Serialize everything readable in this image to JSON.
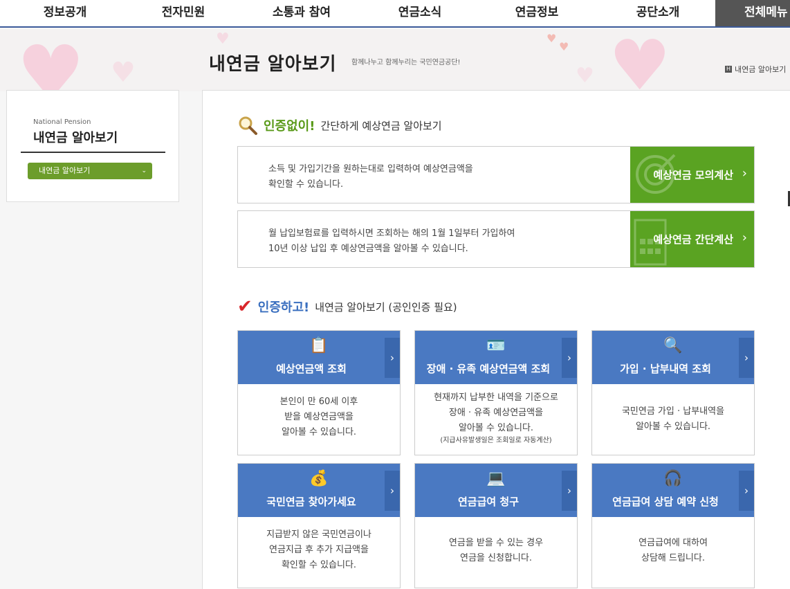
{
  "gnb": {
    "items": [
      "정보공개",
      "전자민원",
      "소통과 참여",
      "연금소식",
      "연금정보",
      "공단소개"
    ],
    "all_menu": "전체메뉴"
  },
  "header": {
    "title": "내연금 알아보기",
    "subtitle": "함께나누고 함께누리는 국민연금공단!",
    "breadcrumb": "내연금 알아보기"
  },
  "sidebar": {
    "eng_title": "National Pension",
    "title": "내연금 알아보기",
    "menu_label": "내연금 알아보기",
    "menu_color": "#6c9d2b"
  },
  "section1": {
    "emphasis": "인증없이!",
    "rest": "간단하게 예상연금 알아보기",
    "rows": [
      {
        "desc1": "소득 및 가입기간을 원하는대로 입력하여 예상연금액을",
        "desc2": "확인할 수 있습니다.",
        "button": "예상연금 모의계산"
      },
      {
        "desc1": "월 납입보험료를 입력하시면 조회하는 해의 1월 1일부터 가입하여",
        "desc2": "10년 이상 납입 후 예상연금액을 알아볼 수 있습니다.",
        "button": "예상연금 간단계산"
      }
    ]
  },
  "section2": {
    "emphasis": "인증하고!",
    "rest": "내연금 알아보기 (공인인증 필요)",
    "cards": [
      {
        "title": "예상연금액 조회",
        "icon": "document-icon",
        "lines": [
          "본인이 만 60세 이후",
          "받을 예상연금액을",
          "알아볼 수 있습니다."
        ],
        "note": ""
      },
      {
        "title": "장애 · 유족 예상연금액 조회",
        "icon": "id-card-icon",
        "lines": [
          "현재까지 납부한 내역을 기준으로",
          "장애 · 유족 예상연금액을",
          "알아볼 수 있습니다."
        ],
        "note": "(지급사유발생일은 조회일로 자동계산)"
      },
      {
        "title": "가입 · 납부내역 조회",
        "icon": "magnifier-icon",
        "lines": [
          "국민연금 가입 · 납부내역을",
          "알아볼 수 있습니다."
        ],
        "note": ""
      },
      {
        "title": "국민연금 찾아가세요",
        "icon": "nps-bag-icon",
        "lines": [
          "지급받지 않은 국민연금이나",
          "연금지급 후 추가 지급액을",
          "확인할 수 있습니다."
        ],
        "note": ""
      },
      {
        "title": "연금급여 청구",
        "icon": "laptop-won-icon",
        "lines": [
          "연금을 받을 수 있는 경우",
          "연금을 신청합니다."
        ],
        "note": ""
      },
      {
        "title": "연금급여 상담 예약 신청",
        "icon": "headset-icon",
        "lines": [
          "연금급여에 대하여",
          "상담해 드립니다."
        ],
        "note": ""
      }
    ],
    "card_color": "#4a79c2"
  },
  "colors": {
    "green_button": "#5aa322",
    "nav_border": "#3c5a9a"
  }
}
